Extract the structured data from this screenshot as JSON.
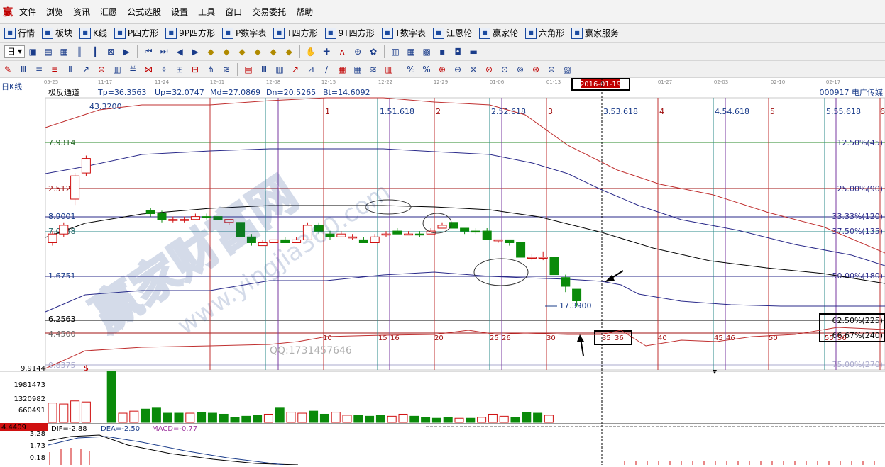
{
  "menu": [
    "文件",
    "浏览",
    "资讯",
    "汇愿",
    "公式选股",
    "设置",
    "工具",
    "窗口",
    "交易委托",
    "帮助"
  ],
  "toolbar1": [
    {
      "icon": "grid-icon",
      "label": "行情"
    },
    {
      "icon": "blocks-icon",
      "label": "板块"
    },
    {
      "icon": "kline-icon",
      "label": "K线"
    },
    {
      "icon": "p-square-icon",
      "label": "P四方形"
    },
    {
      "icon": "9p-square-icon",
      "label": "9P四方形"
    },
    {
      "icon": "pn-icon",
      "label": "P数字表"
    },
    {
      "icon": "t-square-icon",
      "label": "T四方形"
    },
    {
      "icon": "9t-square-icon",
      "label": "9T四方形"
    },
    {
      "icon": "tn-icon",
      "label": "T数字表"
    },
    {
      "icon": "gann-wheel-icon",
      "label": "江恩轮"
    },
    {
      "icon": "yingjia-wheel-icon",
      "label": "赢家轮"
    },
    {
      "icon": "hexagon-icon",
      "label": "六角形"
    },
    {
      "icon": "dollar-icon",
      "label": "赢家服务"
    }
  ],
  "period_selector": "日",
  "chart": {
    "period_label": "日K线",
    "indicator_name": "极反通道",
    "params": [
      "Tp=36.3563",
      "Up=32.0747",
      "Md=27.0869",
      "Dn=20.5265",
      "Bt=14.6092"
    ],
    "stock": "000917 电广传媒",
    "highlight_date": "2016-01-19",
    "date_ticks": [
      "05-25",
      "11-17",
      "11-24",
      "12-01",
      "12-08",
      "12-15",
      "12-22",
      "12-29",
      "01-06",
      "01-13",
      "01-27",
      "02-03",
      "02-10",
      "02-17"
    ],
    "price_labels": [
      "43.3200",
      "7.9314",
      "2.5126",
      "8.9001",
      "7.0938",
      "1.6751",
      "6.2563",
      "4.4500",
      "0.8375"
    ],
    "low_label": "17.3900",
    "pct_labels": [
      "12.50%(45)",
      "25.00%(90)",
      "33.33%(120)",
      "37.50%(135)",
      "50.00%(180)",
      "62.50%(225)",
      "66.67%(240)",
      "75.00%(270)"
    ],
    "cycle_labels": [
      "1",
      "1.51.618",
      "2",
      "2.52.618",
      "3",
      "3.53.618",
      "4",
      "4.54.618",
      "5",
      "5.55.618"
    ],
    "day_counts": [
      "10",
      "15",
      "16",
      "20",
      "25",
      "26",
      "30",
      "35",
      "36",
      "40",
      "45",
      "46",
      "50",
      "55",
      "56"
    ],
    "watermark_cn": "赢家财富网",
    "watermark_url": "www.yingjia360.com",
    "qq_text": "QQ:1731457646",
    "dollar_mark": "$",
    "vol_axis": [
      "9.9144",
      "1981473",
      "1320982",
      "660491"
    ],
    "red_tag": "4.4409",
    "macd": {
      "dif": "DIF=-2.88",
      "dea": "DEA=-2.50",
      "macd": "MACD=-0.77"
    },
    "macd_axis": [
      "3.28",
      "1.73",
      "0.18"
    ],
    "candles": [
      [
        5,
        8,
        9,
        4,
        1
      ],
      [
        8,
        11,
        12,
        7,
        1
      ],
      [
        20,
        28,
        29,
        18,
        1
      ],
      [
        29,
        34,
        35,
        28,
        1
      ],
      [
        16,
        15,
        17,
        14,
        0
      ],
      [
        15,
        13,
        16,
        12,
        0
      ],
      [
        13,
        13,
        14,
        12,
        1
      ],
      [
        13,
        13,
        14,
        12,
        1
      ],
      [
        13,
        14,
        15,
        13,
        1
      ],
      [
        14,
        14,
        15,
        13,
        0
      ],
      [
        14,
        13,
        14,
        13,
        0
      ],
      [
        13,
        12,
        13,
        11,
        1
      ],
      [
        12,
        7,
        12,
        7,
        0
      ],
      [
        7,
        5,
        8,
        4,
        0
      ],
      [
        5,
        4,
        6,
        4,
        1
      ],
      [
        5,
        6,
        6,
        5,
        1
      ],
      [
        6,
        5,
        7,
        5,
        0
      ],
      [
        5,
        6,
        7,
        5,
        1
      ],
      [
        6,
        11,
        12,
        6,
        1
      ],
      [
        11,
        9,
        12,
        8,
        0
      ],
      [
        8,
        7,
        9,
        6,
        0
      ],
      [
        7,
        8,
        9,
        7,
        1
      ],
      [
        7,
        7,
        8,
        6,
        1
      ],
      [
        6,
        5,
        7,
        5,
        0
      ],
      [
        5,
        7,
        8,
        5,
        1
      ],
      [
        8,
        8,
        9,
        7,
        1
      ],
      [
        8,
        9,
        10,
        8,
        0
      ],
      [
        8,
        8,
        9,
        8,
        1
      ],
      [
        8,
        8,
        9,
        7,
        0
      ],
      [
        8,
        9,
        10,
        8,
        1
      ],
      [
        10,
        11,
        12,
        10,
        1
      ],
      [
        12,
        10,
        12,
        10,
        0
      ],
      [
        10,
        9,
        10,
        8,
        0
      ],
      [
        9,
        9,
        10,
        8,
        0
      ],
      [
        9,
        6,
        10,
        6,
        0
      ],
      [
        6,
        6,
        6,
        5,
        1
      ],
      [
        6,
        5,
        6,
        4,
        0
      ],
      [
        5,
        0,
        5,
        0,
        0
      ],
      [
        0,
        0,
        1,
        -1,
        1
      ],
      [
        0,
        0,
        2,
        -1,
        1
      ],
      [
        0,
        -6,
        0,
        -6,
        0
      ],
      [
        -7,
        -10,
        -6,
        -12,
        0
      ],
      [
        -11,
        -15,
        -11,
        -17,
        0
      ]
    ]
  }
}
